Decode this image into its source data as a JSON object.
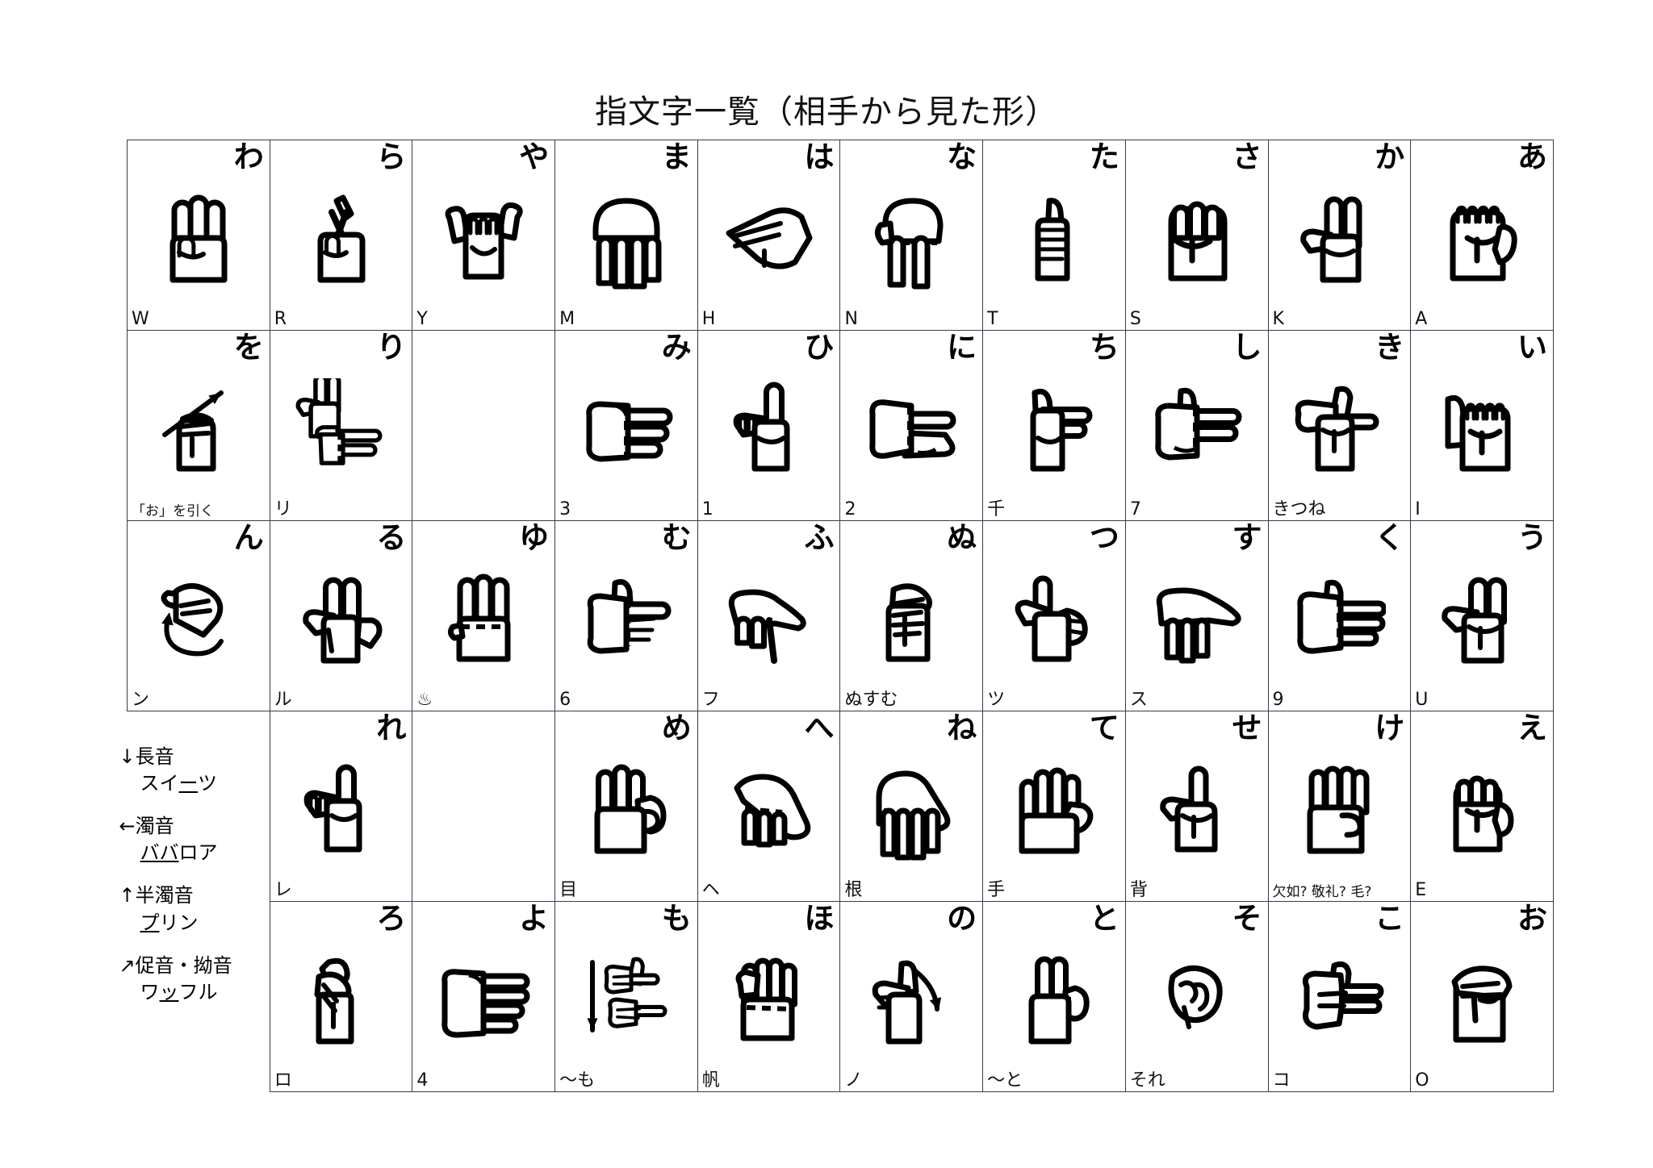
{
  "page": {
    "title": "指文字一覧（相手から見た形）"
  },
  "legend": {
    "items": [
      {
        "arrow": "↓",
        "term": "長音",
        "example_pre": "スイ",
        "example_mark": "ー",
        "example_post": "ツ"
      },
      {
        "arrow": "←",
        "term": "濁音",
        "example_pre": "",
        "example_mark": "ババ",
        "example_post": "ロア"
      },
      {
        "arrow": "↑",
        "term": "半濁音",
        "example_pre": "",
        "example_mark": "プ",
        "example_post": "リン"
      },
      {
        "arrow": "↗",
        "term": "促音・拗音",
        "example_pre": "ワ",
        "example_mark": "ッ",
        "example_post": "フル"
      }
    ]
  },
  "grid": {
    "rows": [
      {
        "row_name": "a-dan",
        "cells": [
          {
            "kana": "わ",
            "note": "W",
            "sign": "wa-three-fingers"
          },
          {
            "kana": "ら",
            "note": "R",
            "sign": "ra-crossed-fingers"
          },
          {
            "kana": "や",
            "note": "Y",
            "sign": "ya-shaka"
          },
          {
            "kana": "ま",
            "note": "M",
            "sign": "ma-four-down"
          },
          {
            "kana": "は",
            "note": "H",
            "sign": "ha-flat-side"
          },
          {
            "kana": "な",
            "note": "N",
            "sign": "na-two-down"
          },
          {
            "kana": "た",
            "note": "T",
            "sign": "ta-thumb-up"
          },
          {
            "kana": "さ",
            "note": "S",
            "sign": "sa-fist"
          },
          {
            "kana": "か",
            "note": "K",
            "sign": "ka-two-up"
          },
          {
            "kana": "あ",
            "note": "A",
            "sign": "a-fist-thumb"
          }
        ]
      },
      {
        "row_name": "i-dan",
        "cells": [
          {
            "kana": "を",
            "note": "「お」を引く",
            "sign": "wo-pull-arrow",
            "note_small": true
          },
          {
            "kana": "り",
            "note": "リ",
            "sign": "ri-double-hand"
          },
          {
            "kana": "",
            "note": "",
            "sign": "blank"
          },
          {
            "kana": "み",
            "note": "3",
            "sign": "mi-three-side"
          },
          {
            "kana": "ひ",
            "note": "1",
            "sign": "hi-index-up"
          },
          {
            "kana": "に",
            "note": "2",
            "sign": "ni-two-side"
          },
          {
            "kana": "ち",
            "note": "千",
            "sign": "chi-thumb-index"
          },
          {
            "kana": "し",
            "note": "7",
            "sign": "shi-seven"
          },
          {
            "kana": "き",
            "note": "きつね",
            "sign": "ki-fox"
          },
          {
            "kana": "い",
            "note": "I",
            "sign": "i-pinky"
          }
        ]
      },
      {
        "row_name": "u-dan",
        "cells": [
          {
            "kana": "ん",
            "note": "ン",
            "sign": "n-hook-arrow"
          },
          {
            "kana": "る",
            "note": "ル",
            "sign": "ru-two-up-open"
          },
          {
            "kana": "ゆ",
            "note": "♨",
            "sign": "yu-three-up"
          },
          {
            "kana": "む",
            "note": "6",
            "sign": "mu-point-side"
          },
          {
            "kana": "ふ",
            "note": "フ",
            "sign": "fu-point-down"
          },
          {
            "kana": "ぬ",
            "note": "ぬすむ",
            "sign": "nu-grab"
          },
          {
            "kana": "つ",
            "note": "ツ",
            "sign": "tsu-two-bent"
          },
          {
            "kana": "す",
            "note": "ス",
            "sign": "su-flat-down"
          },
          {
            "kana": "く",
            "note": "9",
            "sign": "ku-flat-side"
          },
          {
            "kana": "う",
            "note": "U",
            "sign": "u-two-up"
          }
        ]
      },
      {
        "row_name": "e-dan",
        "cells": [
          {
            "kana": "",
            "note": "",
            "sign": "legend"
          },
          {
            "kana": "れ",
            "note": "レ",
            "sign": "re-index-up"
          },
          {
            "kana": "",
            "note": "",
            "sign": "blank"
          },
          {
            "kana": "め",
            "note": "目",
            "sign": "me-three-open"
          },
          {
            "kana": "へ",
            "note": "ヘ",
            "sign": "he-slant"
          },
          {
            "kana": "ね",
            "note": "根",
            "sign": "ne-four-down"
          },
          {
            "kana": "て",
            "note": "手",
            "sign": "te-open-palm"
          },
          {
            "kana": "せ",
            "note": "背",
            "sign": "se-middle-up"
          },
          {
            "kana": "け",
            "note": "欠如? 敬礼? 毛?",
            "sign": "ke-four-up",
            "note_small": true
          },
          {
            "kana": "え",
            "note": "E",
            "sign": "e-fist-bent"
          }
        ]
      },
      {
        "row_name": "o-dan",
        "cells": [
          {
            "kana": "",
            "note": "",
            "sign": "legend-cont"
          },
          {
            "kana": "ろ",
            "note": "ロ",
            "sign": "ro-claw"
          },
          {
            "kana": "よ",
            "note": "4",
            "sign": "yo-four-side"
          },
          {
            "kana": "も",
            "note": "〜も",
            "sign": "mo-down-arrow"
          },
          {
            "kana": "ほ",
            "note": "帆",
            "sign": "ho-flat-up"
          },
          {
            "kana": "の",
            "note": "ノ",
            "sign": "no-stroke-arrow"
          },
          {
            "kana": "と",
            "note": "〜と",
            "sign": "to-two-up-thumb"
          },
          {
            "kana": "そ",
            "note": "それ",
            "sign": "so-small-point"
          },
          {
            "kana": "こ",
            "note": "コ",
            "sign": "ko-bent-side"
          },
          {
            "kana": "お",
            "note": "O",
            "sign": "o-fist-curl"
          }
        ]
      }
    ]
  }
}
